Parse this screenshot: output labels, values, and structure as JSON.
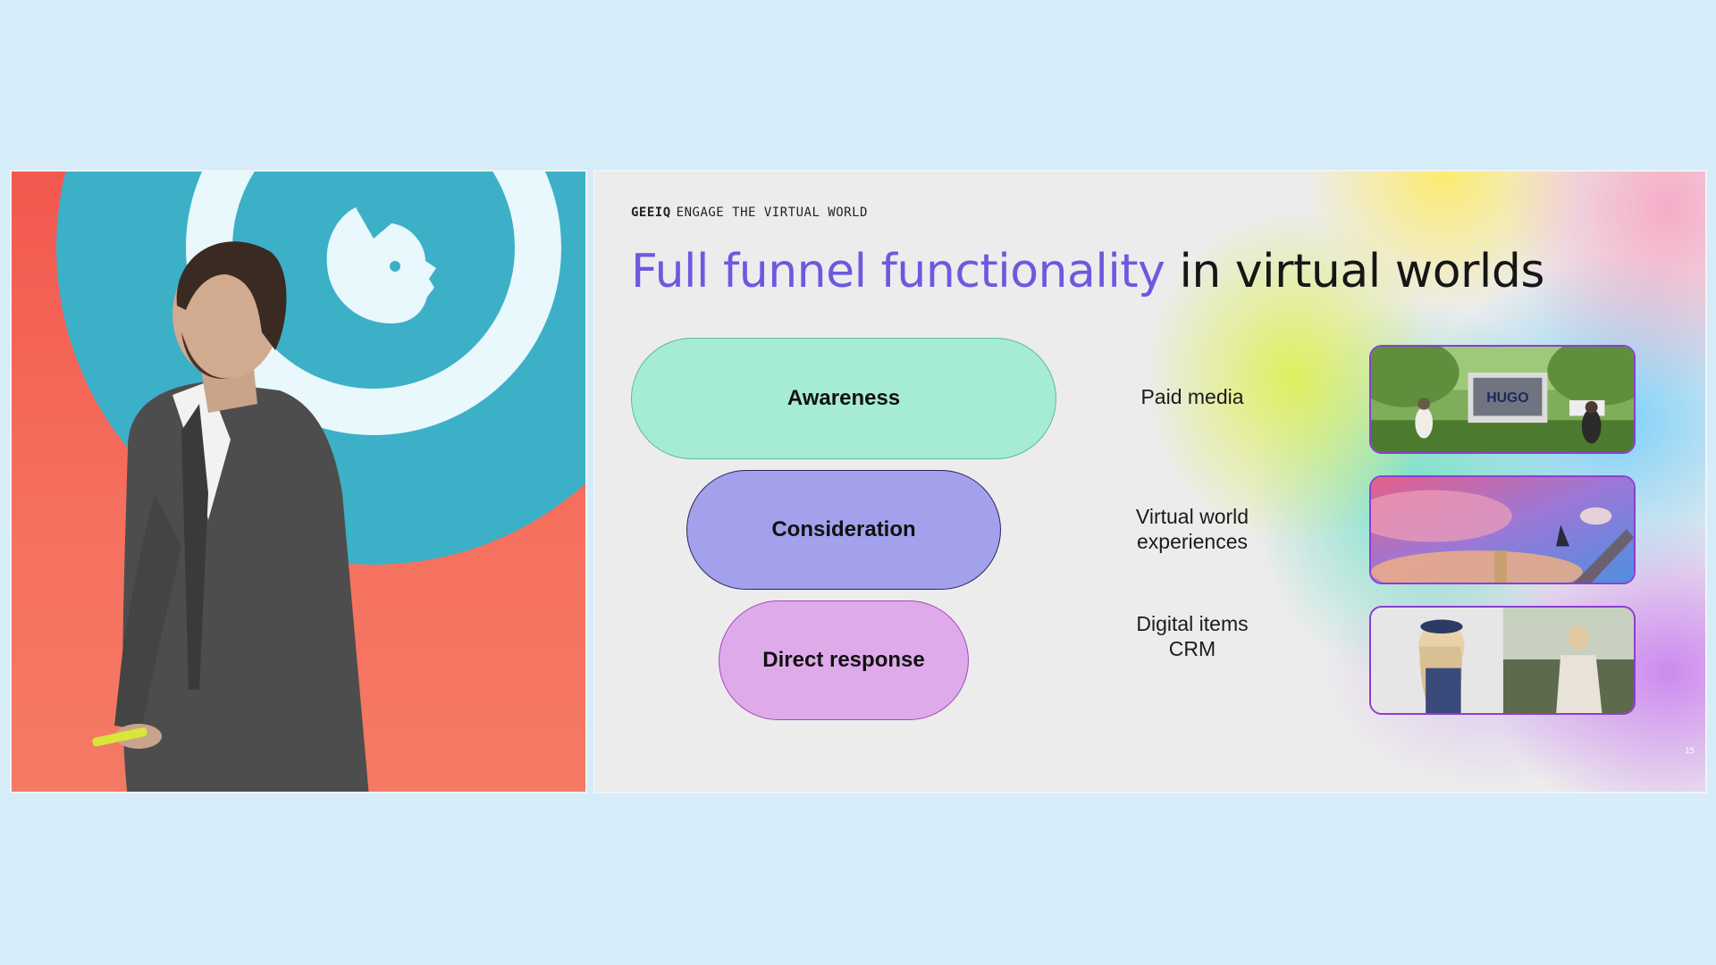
{
  "slide": {
    "kicker_brand": "GEEIQ",
    "kicker_text": "ENGAGE THE VIRTUAL WORLD",
    "headline_accent": "Full funnel functionality",
    "headline_rest": " in virtual worlds",
    "funnel": [
      {
        "label": "Awareness"
      },
      {
        "label": "Consideration"
      },
      {
        "label": "Direct response"
      }
    ],
    "channels": [
      {
        "line1": "Paid media",
        "line2": ""
      },
      {
        "line1": "Virtual world",
        "line2": "experiences"
      },
      {
        "line1": "Digital items",
        "line2": "CRM"
      }
    ],
    "thumb1_sign": "HUGO",
    "page_number": "15"
  },
  "colors": {
    "background": "#d6ecf8",
    "accent_purple": "#6b5ae0",
    "awareness": "#a6ecd3",
    "consideration": "#a3a0ec",
    "direct_response": "#dfaaea"
  }
}
